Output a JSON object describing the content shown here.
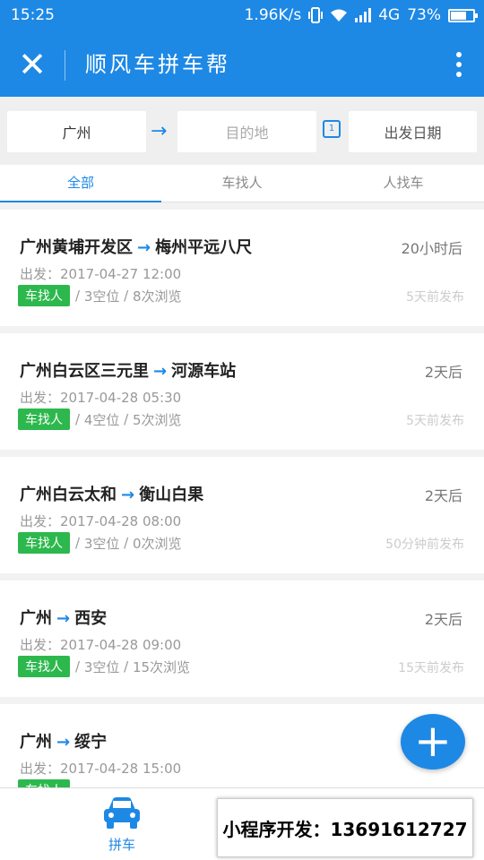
{
  "status_bar": {
    "time": "15:25",
    "network_speed": "1.96K/s",
    "network_type": "4G",
    "battery": "73%",
    "battery_level": 0.73
  },
  "nav": {
    "title": "顺风车拼车帮"
  },
  "search": {
    "from": "广州",
    "to_placeholder": "目的地",
    "date_placeholder": "出发日期"
  },
  "tabs": [
    "全部",
    "车找人",
    "人找车"
  ],
  "trips": [
    {
      "from": "广州黄埔开发区",
      "to": "梅州平远八尺",
      "eta": "20小时后",
      "depart_label": "出发：",
      "depart": "2017-04-27 12:00",
      "type": "车找人",
      "seats": "3空位",
      "views": "8次浏览",
      "posted": "5天前发布"
    },
    {
      "from": "广州白云区三元里",
      "to": "河源车站",
      "eta": "2天后",
      "depart_label": "出发：",
      "depart": "2017-04-28 05:30",
      "type": "车找人",
      "seats": "4空位",
      "views": "5次浏览",
      "posted": "5天前发布"
    },
    {
      "from": "广州白云太和",
      "to": "衡山白果",
      "eta": "2天后",
      "depart_label": "出发：",
      "depart": "2017-04-28 08:00",
      "type": "车找人",
      "seats": "3空位",
      "views": "0次浏览",
      "posted": "50分钟前发布"
    },
    {
      "from": "广州",
      "to": "西安",
      "eta": "2天后",
      "depart_label": "出发：",
      "depart": "2017-04-28 09:00",
      "type": "车找人",
      "seats": "3空位",
      "views": "15次浏览",
      "posted": "15天前发布"
    },
    {
      "from": "广州",
      "to": "绥宁",
      "eta": "",
      "depart_label": "出发：",
      "depart": "2017-04-28 15:00",
      "type": "车找人",
      "seats": "",
      "views": "",
      "posted": ""
    }
  ],
  "fab": {
    "icon": "plus-icon"
  },
  "tabbar": {
    "item_label": "拼车",
    "icon": "car-icon"
  },
  "ad_overlay": {
    "text": "小程序开发：13691612727"
  },
  "colors": {
    "primary": "#1e88e5",
    "badge_green": "#2db84d"
  }
}
